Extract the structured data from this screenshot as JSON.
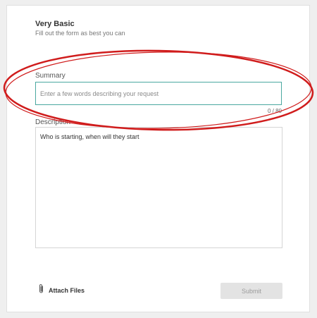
{
  "form": {
    "title": "Very Basic",
    "subtitle": "Fill out the form as best you can"
  },
  "summary": {
    "label": "Summary",
    "placeholder": "Enter a few words describing your request",
    "value": "",
    "counter": "0 / 80"
  },
  "description": {
    "label": "Description",
    "value": "Who is starting, when will they start"
  },
  "attach": {
    "label": "Attach Files",
    "icon": "paperclip-icon"
  },
  "submit": {
    "label": "Submit"
  },
  "annotation": {
    "color": "#d01c1c"
  }
}
